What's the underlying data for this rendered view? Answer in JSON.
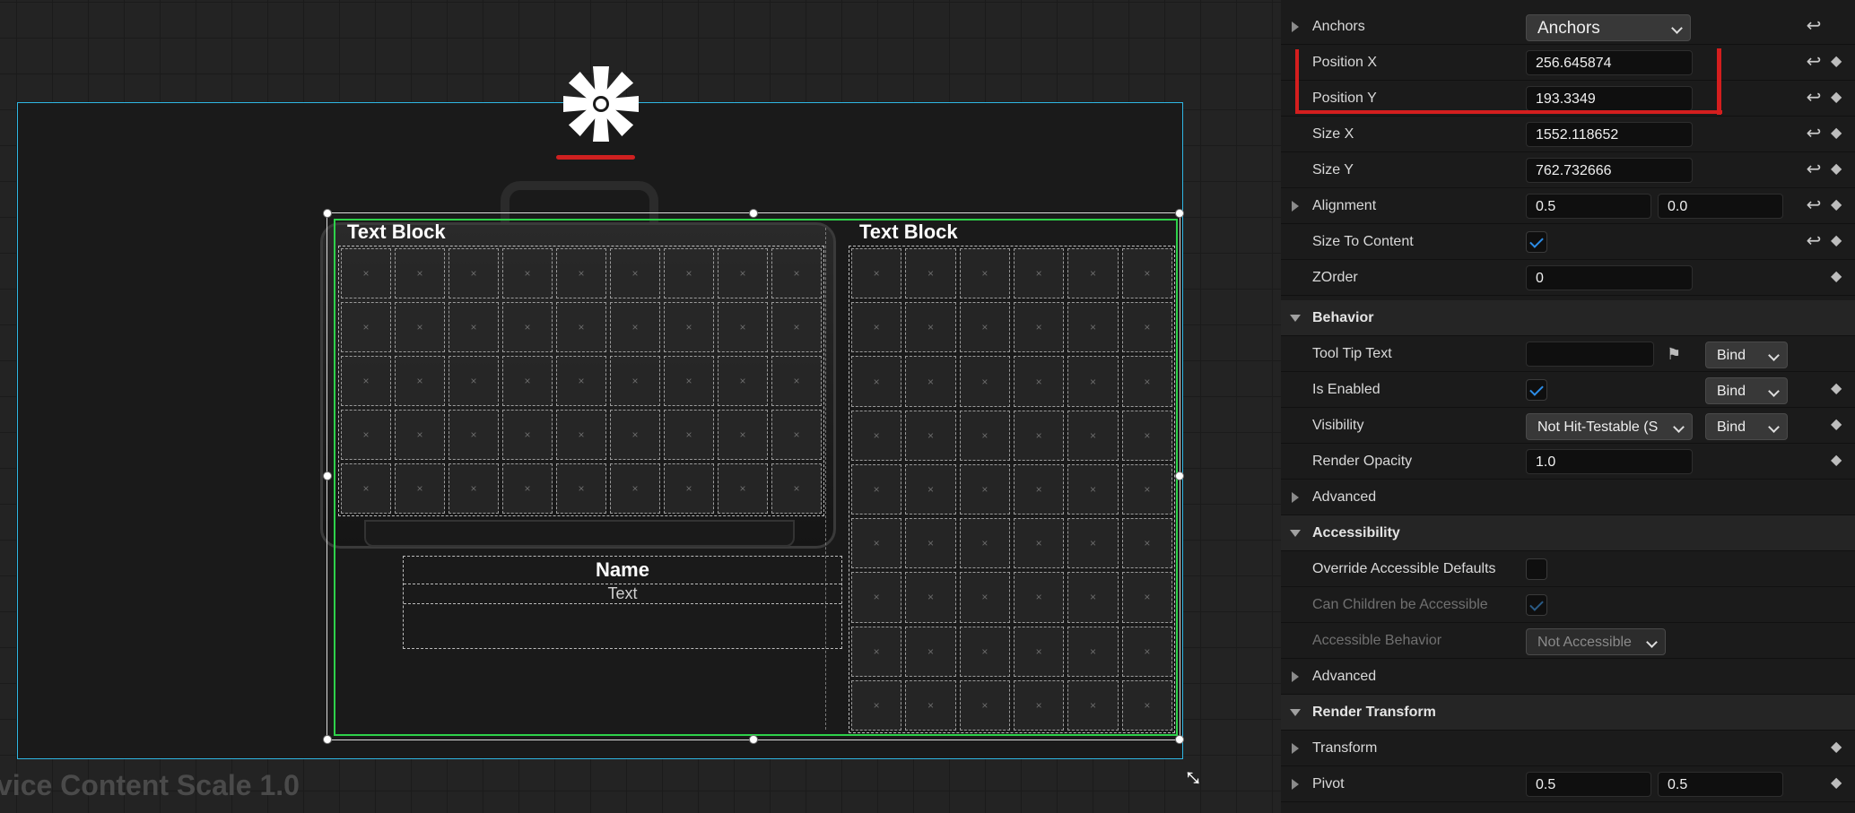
{
  "canvas": {
    "dpi_label": "vice Content Scale 1.0",
    "dpi_label_2": "...",
    "inventory_left": {
      "title": "Text Block",
      "rows": 5,
      "cols": 9
    },
    "inventory_right": {
      "title": "Text Block",
      "rows": 9,
      "cols": 6
    },
    "slot_glyph": "×",
    "name_box": {
      "title": "Name",
      "text": "Text"
    }
  },
  "details": {
    "rows": [
      {
        "kind": "prop",
        "label": "Anchors",
        "expander": true,
        "combo": "Anchors",
        "reset": true
      },
      {
        "kind": "prop",
        "label": "Position X",
        "field": "256.645874",
        "reset": true,
        "key": true
      },
      {
        "kind": "prop",
        "label": "Position Y",
        "field": "193.3349",
        "reset": true,
        "key": true
      },
      {
        "kind": "prop",
        "label": "Size X",
        "field": "1552.118652",
        "reset": true,
        "key": true
      },
      {
        "kind": "prop",
        "label": "Size Y",
        "field": "762.732666",
        "reset": true,
        "key": true
      },
      {
        "kind": "prop",
        "label": "Alignment",
        "expander": true,
        "field": "0.5",
        "field2": "0.0",
        "reset": true,
        "key": true
      },
      {
        "kind": "prop",
        "label": "Size To Content",
        "check": true,
        "reset": true,
        "key": true
      },
      {
        "kind": "prop",
        "label": "ZOrder",
        "field": "0",
        "key": true
      },
      {
        "kind": "cat",
        "label": "Behavior"
      },
      {
        "kind": "prop",
        "label": "Tool Tip Text",
        "field": "",
        "flag": true,
        "bind": "Bind"
      },
      {
        "kind": "prop",
        "label": "Is Enabled",
        "check": true,
        "bind": "Bind",
        "key": true
      },
      {
        "kind": "prop",
        "label": "Visibility",
        "combo": "Not Hit-Testable (S",
        "bind": "Bind",
        "key": true
      },
      {
        "kind": "prop",
        "label": "Render Opacity",
        "field": "1.0",
        "key": true
      },
      {
        "kind": "prop",
        "label": "Advanced",
        "expander": true
      },
      {
        "kind": "cat",
        "label": "Accessibility"
      },
      {
        "kind": "prop",
        "label": "Override Accessible Defaults",
        "check": false
      },
      {
        "kind": "prop",
        "label": "Can Children be Accessible",
        "check": true,
        "dim": true
      },
      {
        "kind": "prop",
        "label": "Accessible Behavior",
        "combo": "Not Accessible",
        "dim": true
      },
      {
        "kind": "prop",
        "label": "Advanced",
        "expander": true
      },
      {
        "kind": "cat",
        "label": "Render Transform"
      },
      {
        "kind": "prop",
        "label": "Transform",
        "expander": true,
        "key": true
      },
      {
        "kind": "prop",
        "label": "Pivot",
        "expander": true,
        "field": "0.5",
        "field2": "0.5",
        "key": true
      }
    ],
    "reset_glyph": "↩",
    "key_glyph": "◆",
    "flag_glyph": "⚑"
  },
  "colors": {
    "selection_green": "#2ed14a",
    "screen_blue": "#2fb6e3",
    "highlight_red": "#d41e1e"
  }
}
